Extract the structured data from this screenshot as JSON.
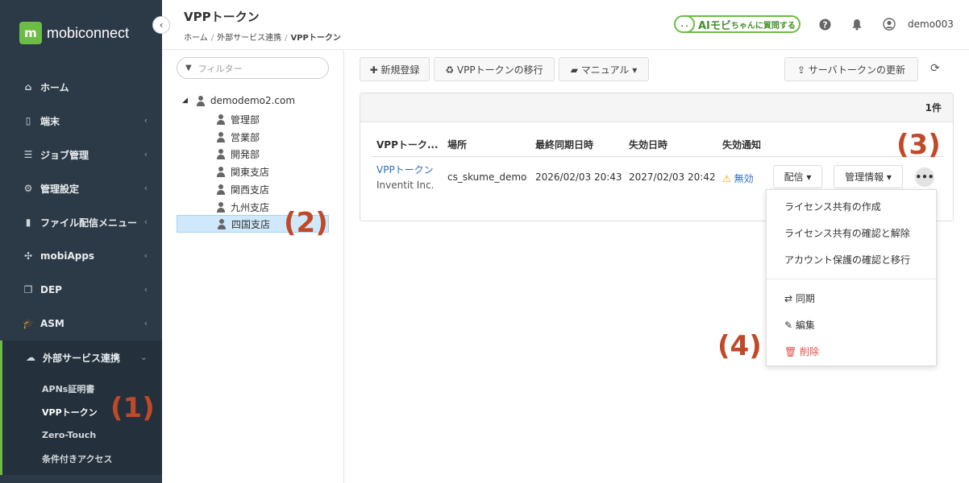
{
  "brand": {
    "logo_letter": "m",
    "name": "mobiconnect"
  },
  "sidebar": {
    "items": [
      {
        "label": "ホーム",
        "icon": "home-icon",
        "glyph": "⌂"
      },
      {
        "label": "端末",
        "icon": "device-icon",
        "glyph": "▯"
      },
      {
        "label": "ジョブ管理",
        "icon": "server-icon",
        "glyph": "☰"
      },
      {
        "label": "管理設定",
        "icon": "gears-icon",
        "glyph": "⚙"
      },
      {
        "label": "ファイル配信メニュー",
        "icon": "file-icon",
        "glyph": "▮"
      },
      {
        "label": "mobiApps",
        "icon": "puzzle-icon",
        "glyph": "✣"
      },
      {
        "label": "DEP",
        "icon": "copy-icon",
        "glyph": "❐"
      },
      {
        "label": "ASM",
        "icon": "graduation-cap-icon",
        "glyph": "🎓"
      },
      {
        "label": "外部サービス連携",
        "icon": "cloud-icon",
        "glyph": "☁"
      }
    ],
    "subitems": [
      "APNs証明書",
      "VPPトークン",
      "Zero-Touch",
      "条件付きアクセス"
    ],
    "collapse_glyph": "‹"
  },
  "header": {
    "title": "VPPトークン",
    "breadcrumb": [
      "ホーム",
      "外部サービス連携",
      "VPPトークン"
    ],
    "ai_face": ". .",
    "ai_strong": "AIモビ",
    "ai_rest": "ちゃんに質問する",
    "user": "demo003"
  },
  "tree": {
    "filter_placeholder": "フィルター",
    "root": "demodemo2.com",
    "children": [
      "管理部",
      "営業部",
      "開発部",
      "関東支店",
      "関西支店",
      "九州支店",
      "四国支店"
    ]
  },
  "toolbar": {
    "new": "✚ 新規登録",
    "migrate": "♻ VPPトークンの移行",
    "manual": "▰ マニュアル ▾",
    "update_server_token": "⇪ サーバトークンの更新"
  },
  "table": {
    "count": "1件",
    "headers": [
      "VPPトーク...",
      "場所",
      "最終同期日時",
      "失効日時",
      "失効通知"
    ],
    "row": {
      "token_link": "VPPトークン",
      "org": "Inventit Inc.",
      "location": "cs_skume_demo",
      "last_sync": "2026/02/03 20:43",
      "expire": "2027/02/03 20:42",
      "notify": "無効"
    },
    "deliver_btn": "配信 ▾",
    "manage_btn": "管理情報 ▾",
    "more_btn": "•••"
  },
  "dropdown": {
    "items": [
      "ライセンス共有の作成",
      "ライセンス共有の確認と解除",
      "アカウント保護の確認と移行"
    ],
    "sync": "⇄ 同期",
    "edit": "✎ 編集",
    "delete": "🗑 削除"
  },
  "annotations": [
    "(1)",
    "(2)",
    "(3)",
    "(4)"
  ]
}
